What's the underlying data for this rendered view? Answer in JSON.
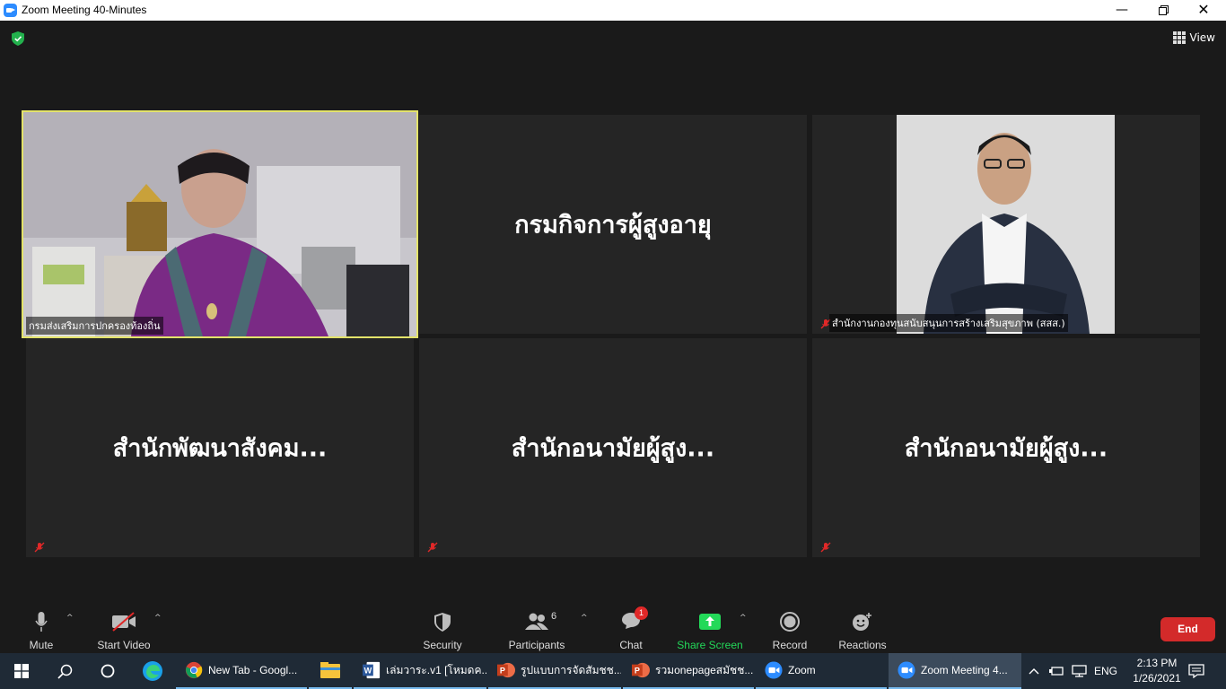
{
  "window": {
    "title": "Zoom Meeting 40-Minutes"
  },
  "meeting": {
    "view_label": "View",
    "tiles": [
      {
        "id": "t1",
        "label": "กรมส่งเสริมการปกครองท้องถิ่น",
        "big_name": "",
        "muted": false
      },
      {
        "id": "t2",
        "label": "",
        "big_name": "กรมกิจการผู้สูงอายุ",
        "muted": false
      },
      {
        "id": "t3",
        "label": "สำนักงานกองทุนสนับสนุนการสร้างเสริมสุขภาพ (สสส.)",
        "big_name": "",
        "muted": true
      },
      {
        "id": "t4",
        "label": "",
        "big_name": "สำนักพัฒนาสังคม...",
        "muted": true
      },
      {
        "id": "t5",
        "label": "",
        "big_name": "สำนักอนามัยผู้สูง...",
        "muted": true
      },
      {
        "id": "t6",
        "label": "",
        "big_name": "สำนักอนามัยผู้สูง...",
        "muted": true
      }
    ]
  },
  "toolbar": {
    "mute": "Mute",
    "start_video": "Start Video",
    "security": "Security",
    "participants": "Participants",
    "participants_count": "6",
    "chat": "Chat",
    "chat_badge": "1",
    "share_screen": "Share Screen",
    "record": "Record",
    "reactions": "Reactions",
    "end": "End",
    "share_color": "#23d959"
  },
  "taskbar": {
    "apps": [
      {
        "label": "New Tab - Googl...",
        "icon": "chrome-icon"
      },
      {
        "label": "",
        "icon": "file-explorer-icon"
      },
      {
        "label": "เล่มวาระ.v1 [โหมดค...",
        "icon": "word-icon"
      },
      {
        "label": "รูปแบบการจัดสัมชช...",
        "icon": "powerpoint-icon"
      },
      {
        "label": "รวมonepageสมัชช...",
        "icon": "powerpoint-icon"
      },
      {
        "label": "Zoom",
        "icon": "zoom-icon"
      },
      {
        "label": "Zoom Meeting 4...",
        "icon": "zoom-icon"
      }
    ],
    "language": "ENG",
    "time": "2:13 PM",
    "date": "1/26/2021"
  }
}
